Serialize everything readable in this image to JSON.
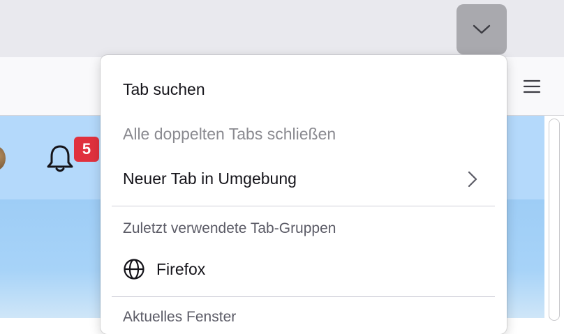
{
  "menu": {
    "search_tabs": "Tab suchen",
    "close_duplicates": "Alle doppelten Tabs schließen",
    "new_tab_nearby": "Neuer Tab in Umgebung",
    "recent_groups_header": "Zuletzt verwendete Tab-Gruppen",
    "groups": [
      {
        "label": "Firefox",
        "icon": "globe-icon"
      }
    ],
    "current_window_header": "Aktuelles Fenster"
  },
  "page": {
    "notification_count": "5"
  },
  "colors": {
    "badge": "#e0313e",
    "site_header": "#b4d9fb",
    "list_button_active": "#a9a9ae"
  }
}
